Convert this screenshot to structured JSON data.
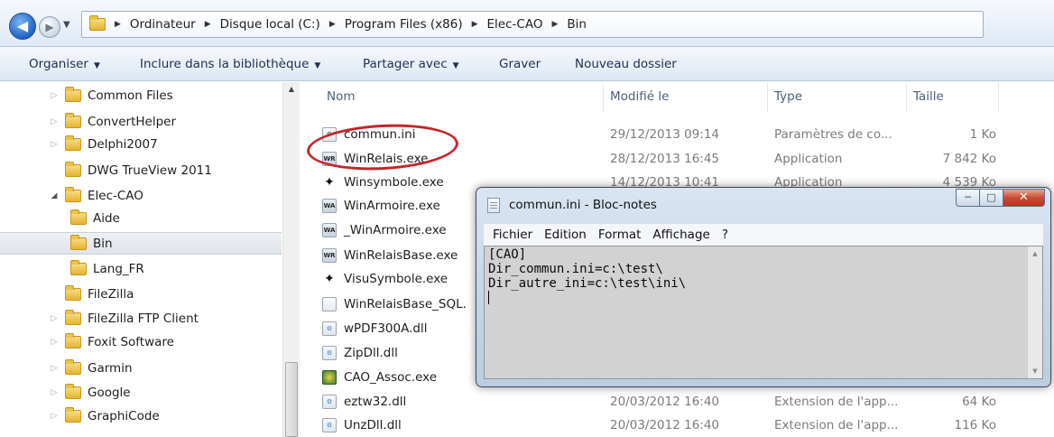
{
  "explorer": {
    "breadcrumb": [
      "Ordinateur",
      "Disque local (C:)",
      "Program Files (x86)",
      "Elec-CAO",
      "Bin"
    ],
    "toolbar": {
      "organize": "Organiser",
      "include": "Inclure dans la bibliothèque",
      "share": "Partager avec",
      "burn": "Graver",
      "new_folder": "Nouveau dossier"
    },
    "tree": [
      {
        "label": "Common Files",
        "level": 1,
        "expandable": true
      },
      {
        "label": "ConvertHelper",
        "level": 1,
        "expandable": true
      },
      {
        "label": "Delphi2007",
        "level": 1,
        "expandable": true
      },
      {
        "label": "DWG TrueView 2011",
        "level": 1,
        "expandable": false
      },
      {
        "label": "Elec-CAO",
        "level": 1,
        "expandable": true,
        "expanded": true
      },
      {
        "label": "Aide",
        "level": 2,
        "expandable": false
      },
      {
        "label": "Bin",
        "level": 2,
        "expandable": false,
        "selected": true
      },
      {
        "label": "Lang_FR",
        "level": 2,
        "expandable": false
      },
      {
        "label": "FileZilla",
        "level": 1,
        "expandable": false
      },
      {
        "label": "FileZilla FTP Client",
        "level": 1,
        "expandable": true
      },
      {
        "label": "Foxit Software",
        "level": 1,
        "expandable": true
      },
      {
        "label": "Garmin",
        "level": 1,
        "expandable": true
      },
      {
        "label": "Google",
        "level": 1,
        "expandable": true
      },
      {
        "label": "GraphiCode",
        "level": 1,
        "expandable": true
      }
    ],
    "columns": {
      "name": "Nom",
      "modified": "Modifié le",
      "type": "Type",
      "size": "Taille"
    },
    "files": [
      {
        "name": "commun.ini",
        "date": "29/12/2013 09:14",
        "type": "Paramètres de co...",
        "size": "1 Ko",
        "icon": "ini-file-icon"
      },
      {
        "name": "WinRelais.exe",
        "date": "28/12/2013 16:45",
        "type": "Application",
        "size": "7 842 Ko",
        "icon": "app-icon"
      },
      {
        "name": "Winsymbole.exe",
        "date": "14/12/2013 10:41",
        "type": "Application",
        "size": "4 539 Ko",
        "icon": "symbol-app-icon"
      },
      {
        "name": "WinArmoire.exe",
        "date": "",
        "type": "",
        "size": "",
        "icon": "app-icon"
      },
      {
        "name": "_WinArmoire.exe",
        "date": "",
        "type": "",
        "size": "",
        "icon": "app-icon"
      },
      {
        "name": "WinRelaisBase.exe",
        "date": "",
        "type": "",
        "size": "",
        "icon": "app-icon"
      },
      {
        "name": "VisuSymbole.exe",
        "date": "",
        "type": "",
        "size": "",
        "icon": "symbol-app-icon"
      },
      {
        "name": "WinRelaisBase_SQL.",
        "date": "",
        "type": "",
        "size": "",
        "icon": "file-icon"
      },
      {
        "name": "wPDF300A.dll",
        "date": "",
        "type": "",
        "size": "",
        "icon": "dll-icon"
      },
      {
        "name": "ZipDll.dll",
        "date": "",
        "type": "",
        "size": "",
        "icon": "dll-icon"
      },
      {
        "name": "CAO_Assoc.exe",
        "date": "",
        "type": "",
        "size": "",
        "icon": "cao-app-icon"
      },
      {
        "name": "eztw32.dll",
        "date": "20/03/2012 16:40",
        "type": "Extension de l'app...",
        "size": "64 Ko",
        "icon": "dll-icon"
      },
      {
        "name": "UnzDll.dll",
        "date": "20/03/2012 16:40",
        "type": "Extension de l'app...",
        "size": "116 Ko",
        "icon": "dll-icon"
      }
    ]
  },
  "notepad": {
    "title": "commun.ini - Bloc-notes",
    "menus": [
      "Fichier",
      "Edition",
      "Format",
      "Affichage",
      "?"
    ],
    "lines": [
      "[CAO]",
      "Dir_commun.ini=c:\\test\\",
      "Dir_autre_ini=c:\\test\\ini\\"
    ]
  },
  "annotation": {
    "highlighted_file": "WinRelais.exe",
    "color": "#c4262b"
  }
}
